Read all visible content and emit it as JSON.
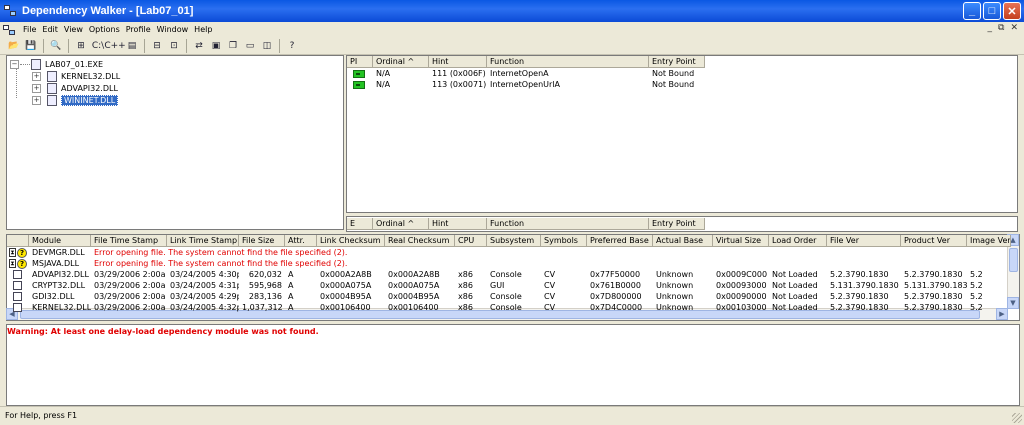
{
  "window": {
    "title": "Dependency Walker - [Lab07_01]",
    "minimize": "_",
    "maximize": "□",
    "close": "✕"
  },
  "menu": [
    "File",
    "Edit",
    "View",
    "Options",
    "Profile",
    "Window",
    "Help"
  ],
  "mdi_controls": [
    "_",
    "⧉",
    "✕"
  ],
  "toolbar": [
    {
      "icon": "open-folder-icon",
      "glyph": "📂"
    },
    {
      "icon": "save-icon",
      "glyph": "💾"
    },
    {
      "sep": true
    },
    {
      "icon": "find-icon",
      "glyph": "🔍"
    },
    {
      "sep": true
    },
    {
      "icon": "tree-view-icon",
      "glyph": "⊞"
    },
    {
      "icon": "full-paths-icon",
      "glyph": "C:\\"
    },
    {
      "icon": "undecorate-icon",
      "glyph": "C++"
    },
    {
      "icon": "module-list-icon",
      "glyph": "▤"
    },
    {
      "sep": true
    },
    {
      "icon": "expand-all-icon",
      "glyph": "⊟"
    },
    {
      "icon": "collapse-all-icon",
      "glyph": "⊡"
    },
    {
      "sep": true
    },
    {
      "icon": "highlight-icon",
      "glyph": "⇄"
    },
    {
      "icon": "properties-icon",
      "glyph": "▣"
    },
    {
      "icon": "cascade-icon",
      "glyph": "❐"
    },
    {
      "icon": "tile-horizontal-icon",
      "glyph": "▭"
    },
    {
      "icon": "tile-vertical-icon",
      "glyph": "◫"
    },
    {
      "sep": true
    },
    {
      "icon": "context-help-icon",
      "glyph": "?"
    }
  ],
  "tree": {
    "root": "LAB07_01.EXE",
    "children": [
      "KERNEL32.DLL",
      "ADVAPI32.DLL",
      "WININET.DLL"
    ],
    "selected": "WININET.DLL"
  },
  "imports": {
    "columns": [
      "PI",
      "Ordinal ^",
      "Hint",
      "Function",
      "Entry Point"
    ],
    "rows": [
      {
        "ordinal": "N/A",
        "hint": "111 (0x006F)",
        "function": "InternetOpenA",
        "entry": "Not Bound"
      },
      {
        "ordinal": "N/A",
        "hint": "113 (0x0071)",
        "function": "InternetOpenUrlA",
        "entry": "Not Bound"
      }
    ]
  },
  "exports": {
    "columns": [
      "E",
      "Ordinal ^",
      "Hint",
      "Function",
      "Entry Point"
    ]
  },
  "modules": {
    "columns": [
      "",
      "Module",
      "File Time Stamp",
      "Link Time Stamp",
      "File Size",
      "Attr.",
      "Link Checksum",
      "Real Checksum",
      "CPU",
      "Subsystem",
      "Symbols",
      "Preferred Base",
      "Actual Base",
      "Virtual Size",
      "Load Order",
      "File Ver",
      "Product Ver",
      "Image Ver"
    ],
    "error_rows": [
      {
        "module": "DEVMGR.DLL",
        "message": "Error opening file. The system cannot find the file specified (2)."
      },
      {
        "module": "MSJAVA.DLL",
        "message": "Error opening file. The system cannot find the file specified (2)."
      }
    ],
    "rows": [
      [
        "ADVAPI32.DLL",
        "03/29/2006  2:00a",
        "03/24/2005  4:30p",
        "620,032",
        "A",
        "0x000A2A8B",
        "0x000A2A8B",
        "x86",
        "Console",
        "CV",
        "0x77F50000",
        "Unknown",
        "0x0009C000",
        "Not Loaded",
        "5.2.3790.1830",
        "5.2.3790.1830",
        "5.2"
      ],
      [
        "CRYPT32.DLL",
        "03/29/2006  2:00a",
        "03/24/2005  4:31p",
        "595,968",
        "A",
        "0x000A075A",
        "0x000A075A",
        "x86",
        "GUI",
        "CV",
        "0x761B0000",
        "Unknown",
        "0x00093000",
        "Not Loaded",
        "5.131.3790.1830",
        "5.131.3790.1830",
        "5.2"
      ],
      [
        "GDI32.DLL",
        "03/29/2006  2:00a",
        "03/24/2005  4:29p",
        "283,136",
        "A",
        "0x0004B95A",
        "0x0004B95A",
        "x86",
        "Console",
        "CV",
        "0x7D800000",
        "Unknown",
        "0x00090000",
        "Not Loaded",
        "5.2.3790.1830",
        "5.2.3790.1830",
        "5.2"
      ],
      [
        "KERNEL32.DLL",
        "03/29/2006  2:00a",
        "03/24/2005  4:32p",
        "1,037,312",
        "A",
        "0x00106400",
        "0x00106400",
        "x86",
        "Console",
        "CV",
        "0x7D4C0000",
        "Unknown",
        "0x00103000",
        "Not Loaded",
        "5.2.3790.1830",
        "5.2.3790.1830",
        "5.2"
      ]
    ]
  },
  "log": {
    "warning": "Warning: At least one delay-load dependency module was not found."
  },
  "status": {
    "text": "For Help, press F1"
  }
}
